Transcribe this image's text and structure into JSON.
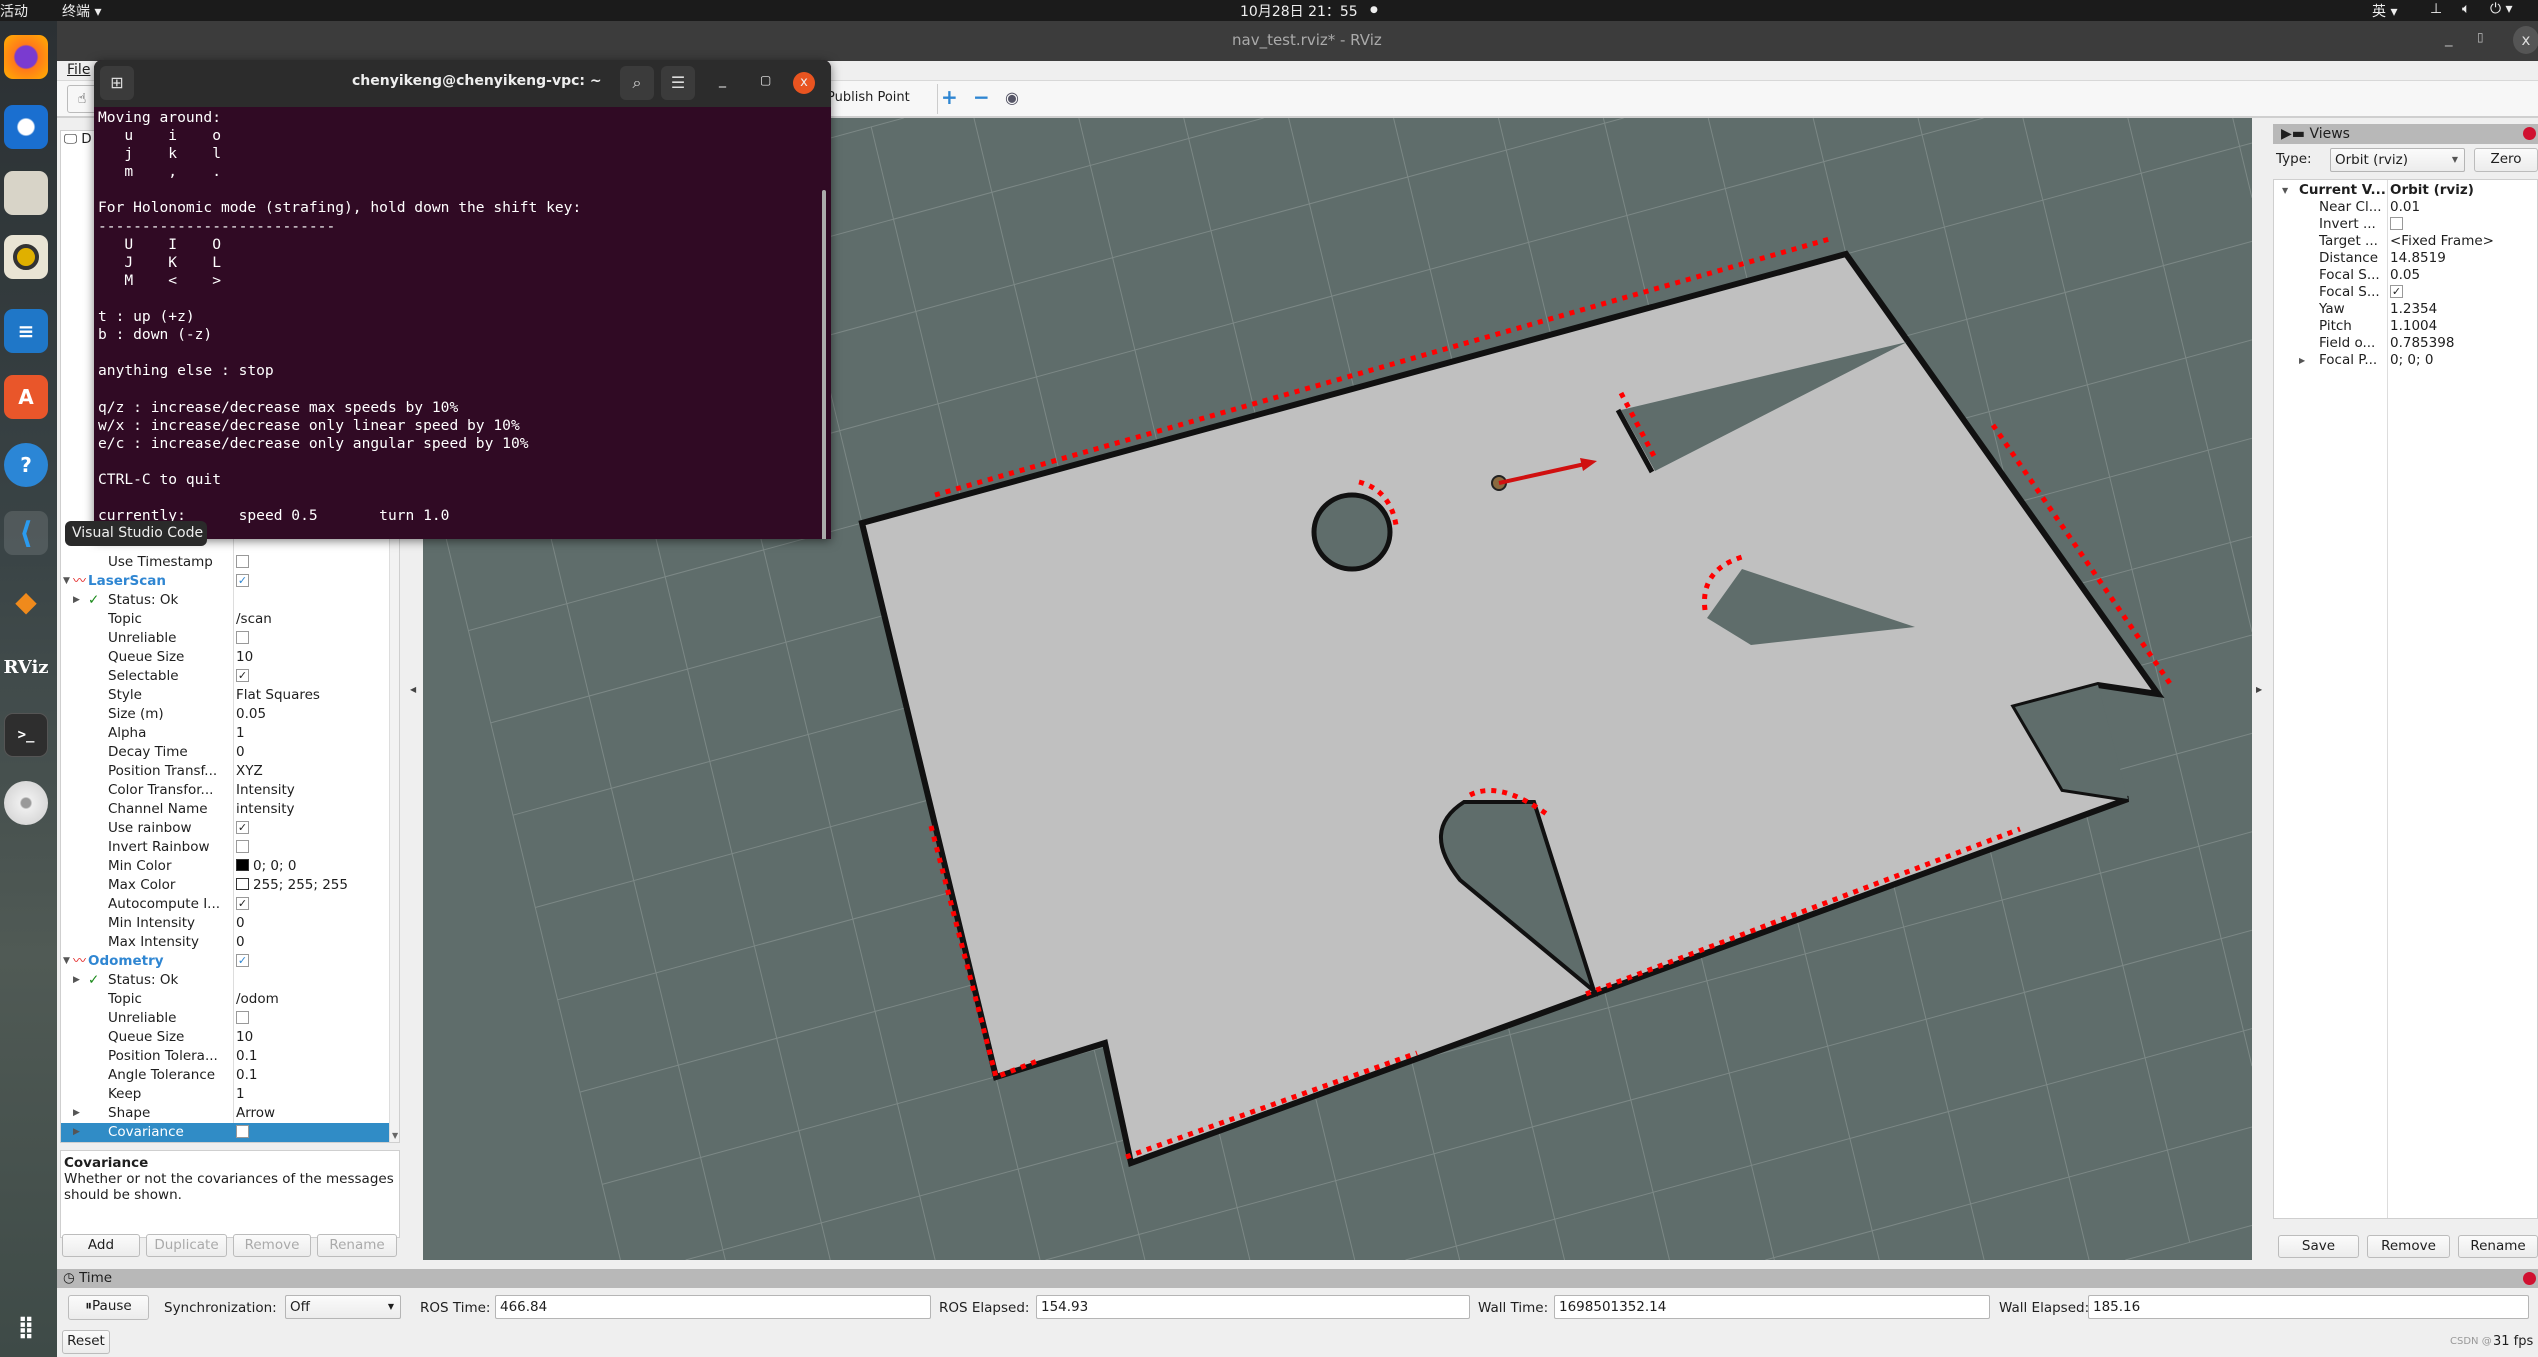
{
  "topbar": {
    "activities": "活动",
    "app_menu": "终端 ▾",
    "clock": "10月28日 21：55",
    "input_method": "英 ▾"
  },
  "dock": {
    "tooltip": "Visual Studio Code",
    "rviz_label": "RViz"
  },
  "window": {
    "title": "nav_test.rviz* - RViz"
  },
  "menubar": {
    "file": "File"
  },
  "toolbar": {
    "publish_point": "Publish Point",
    "zoom_in": "+",
    "zoom_out": "−"
  },
  "displays": {
    "rows": [
      {
        "name": "Use Timestamp",
        "kind": "prop",
        "check": false
      },
      {
        "name": "LaserScan",
        "kind": "display",
        "check": true,
        "expander": "▼",
        "icon": "laserscan-icon"
      },
      {
        "name": "Status: Ok",
        "kind": "status",
        "expander": "▶"
      },
      {
        "name": "Topic",
        "kind": "prop",
        "value": "/scan"
      },
      {
        "name": "Unreliable",
        "kind": "prop",
        "check": false
      },
      {
        "name": "Queue Size",
        "kind": "prop",
        "value": "10"
      },
      {
        "name": "Selectable",
        "kind": "prop",
        "check": true
      },
      {
        "name": "Style",
        "kind": "prop",
        "value": "Flat Squares"
      },
      {
        "name": "Size (m)",
        "kind": "prop",
        "value": "0.05"
      },
      {
        "name": "Alpha",
        "kind": "prop",
        "value": "1"
      },
      {
        "name": "Decay Time",
        "kind": "prop",
        "value": "0"
      },
      {
        "name": "Position Transf...",
        "kind": "prop",
        "value": "XYZ"
      },
      {
        "name": "Color Transfor...",
        "kind": "prop",
        "value": "Intensity"
      },
      {
        "name": "Channel Name",
        "kind": "prop",
        "value": "intensity"
      },
      {
        "name": "Use rainbow",
        "kind": "prop",
        "check": true
      },
      {
        "name": "Invert Rainbow",
        "kind": "prop",
        "check": false
      },
      {
        "name": "Min Color",
        "kind": "prop",
        "value": "0; 0; 0",
        "swatch": "#000000"
      },
      {
        "name": "Max Color",
        "kind": "prop",
        "value": "255; 255; 255",
        "swatch": "#ffffff"
      },
      {
        "name": "Autocompute I...",
        "kind": "prop",
        "check": true
      },
      {
        "name": "Min Intensity",
        "kind": "prop",
        "value": "0"
      },
      {
        "name": "Max Intensity",
        "kind": "prop",
        "value": "0"
      },
      {
        "name": "Odometry",
        "kind": "display",
        "check": true,
        "expander": "▼",
        "icon": "odometry-icon"
      },
      {
        "name": "Status: Ok",
        "kind": "status",
        "expander": "▶"
      },
      {
        "name": "Topic",
        "kind": "prop",
        "value": "/odom"
      },
      {
        "name": "Unreliable",
        "kind": "prop",
        "check": false
      },
      {
        "name": "Queue Size",
        "kind": "prop",
        "value": "10"
      },
      {
        "name": "Position Tolera...",
        "kind": "prop",
        "value": "0.1"
      },
      {
        "name": "Angle Tolerance",
        "kind": "prop",
        "value": "0.1"
      },
      {
        "name": "Keep",
        "kind": "prop",
        "value": "1"
      },
      {
        "name": "Shape",
        "kind": "prop",
        "value": "Arrow",
        "expander": "▶"
      },
      {
        "name": "Covariance",
        "kind": "prop",
        "check": false,
        "expander": "▶",
        "selected": true
      }
    ],
    "description_title": "Covariance",
    "description_text": "Whether or not the covariances of the messages should be shown.",
    "buttons": {
      "add": "Add",
      "duplicate": "Duplicate",
      "remove": "Remove",
      "rename": "Rename"
    }
  },
  "views": {
    "title": "Views",
    "type_label": "Type:",
    "type_value": "Orbit (rviz)",
    "zero": "Zero",
    "rows": [
      {
        "name": "Current V...",
        "value": "Orbit (rviz)",
        "bold": true,
        "expander": "▼"
      },
      {
        "name": "Near Cl...",
        "value": "0.01"
      },
      {
        "name": "Invert ...",
        "check": false
      },
      {
        "name": "Target ...",
        "value": "<Fixed Frame>"
      },
      {
        "name": "Distance",
        "value": "14.8519"
      },
      {
        "name": "Focal S...",
        "value": "0.05"
      },
      {
        "name": "Focal S...",
        "check": true
      },
      {
        "name": "Yaw",
        "value": "1.2354"
      },
      {
        "name": "Pitch",
        "value": "1.1004"
      },
      {
        "name": "Field o...",
        "value": "0.785398"
      },
      {
        "name": "Focal P...",
        "value": "0; 0; 0",
        "expander": "▶"
      }
    ],
    "buttons": {
      "save": "Save",
      "remove": "Remove",
      "rename": "Rename"
    }
  },
  "time": {
    "title": "Time",
    "pause": "Pause",
    "sync_label": "Synchronization:",
    "sync_value": "Off",
    "ros_time_label": "ROS Time:",
    "ros_time": "466.84",
    "ros_elapsed_label": "ROS Elapsed:",
    "ros_elapsed": "154.93",
    "wall_time_label": "Wall Time:",
    "wall_time": "1698501352.14",
    "wall_elapsed_label": "Wall Elapsed:",
    "wall_elapsed": "185.16",
    "reset": "Reset",
    "fps": "31 fps",
    "watermark": "CSDN @"
  },
  "terminal": {
    "title": "chenyikeng@chenyikeng-vpc: ~",
    "lines": [
      "Moving around:",
      "   u    i    o",
      "   j    k    l",
      "   m    ,    .",
      "",
      "For Holonomic mode (strafing), hold down the shift key:",
      "---------------------------",
      "   U    I    O",
      "   J    K    L",
      "   M    <    >",
      "",
      "t : up (+z)",
      "b : down (-z)",
      "",
      "anything else : stop",
      "",
      "q/z : increase/decrease max speeds by 10%",
      "w/x : increase/decrease only linear speed by 10%",
      "e/c : increase/decrease only angular speed by 10%",
      "",
      "CTRL-C to quit",
      "",
      "currently:\tspeed 0.5 \tturn 1.0"
    ]
  },
  "colors": {
    "viewport_bg": "#5f6d6b",
    "map_free": "#c0c0c0",
    "scan": "#ff0000",
    "terminal_bg": "#300a24",
    "selection": "#308cc6"
  }
}
